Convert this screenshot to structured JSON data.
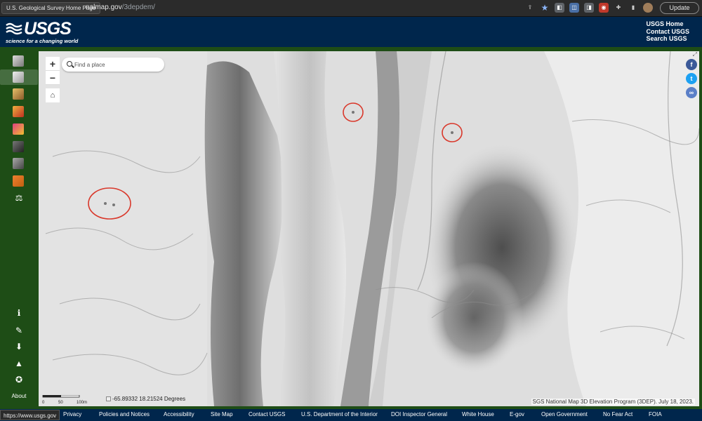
{
  "browser": {
    "tooltip": "U.S. Geological Survey Home Page",
    "url_host": "nalmap.gov",
    "url_path": "/3depdem/",
    "update_label": "Update"
  },
  "header": {
    "logo_text": "USGS",
    "logo_tagline": "science for a changing world",
    "links": [
      "USGS Home",
      "Contact USGS",
      "Search USGS"
    ]
  },
  "map": {
    "search_placeholder": "Find a place",
    "zoom_in": "+",
    "zoom_out": "−",
    "coords": "-65.89332  18.21524 Degrees",
    "scale_labels": [
      "0",
      "50",
      "100m"
    ],
    "attribution": "SGS National Map 3D Elevation Program (3DEP). July 18, 2023."
  },
  "sidebar": {
    "about_label": "About"
  },
  "footer": {
    "status_url": "https://www.usgs.gov",
    "links": [
      "Privacy",
      "Policies and Notices",
      "Accessibility",
      "Site Map",
      "Contact USGS",
      "U.S. Department of the Interior",
      "DOI Inspector General",
      "White House",
      "E-gov",
      "Open Government",
      "No Fear Act",
      "FOIA"
    ]
  },
  "colors": {
    "usgs_navy": "#00264c",
    "sidebar_green": "#1e4d16",
    "annotation_red": "#d9382b",
    "facebook": "#3b5998",
    "twitter": "#1da1f2",
    "link": "#5b7fc7"
  }
}
